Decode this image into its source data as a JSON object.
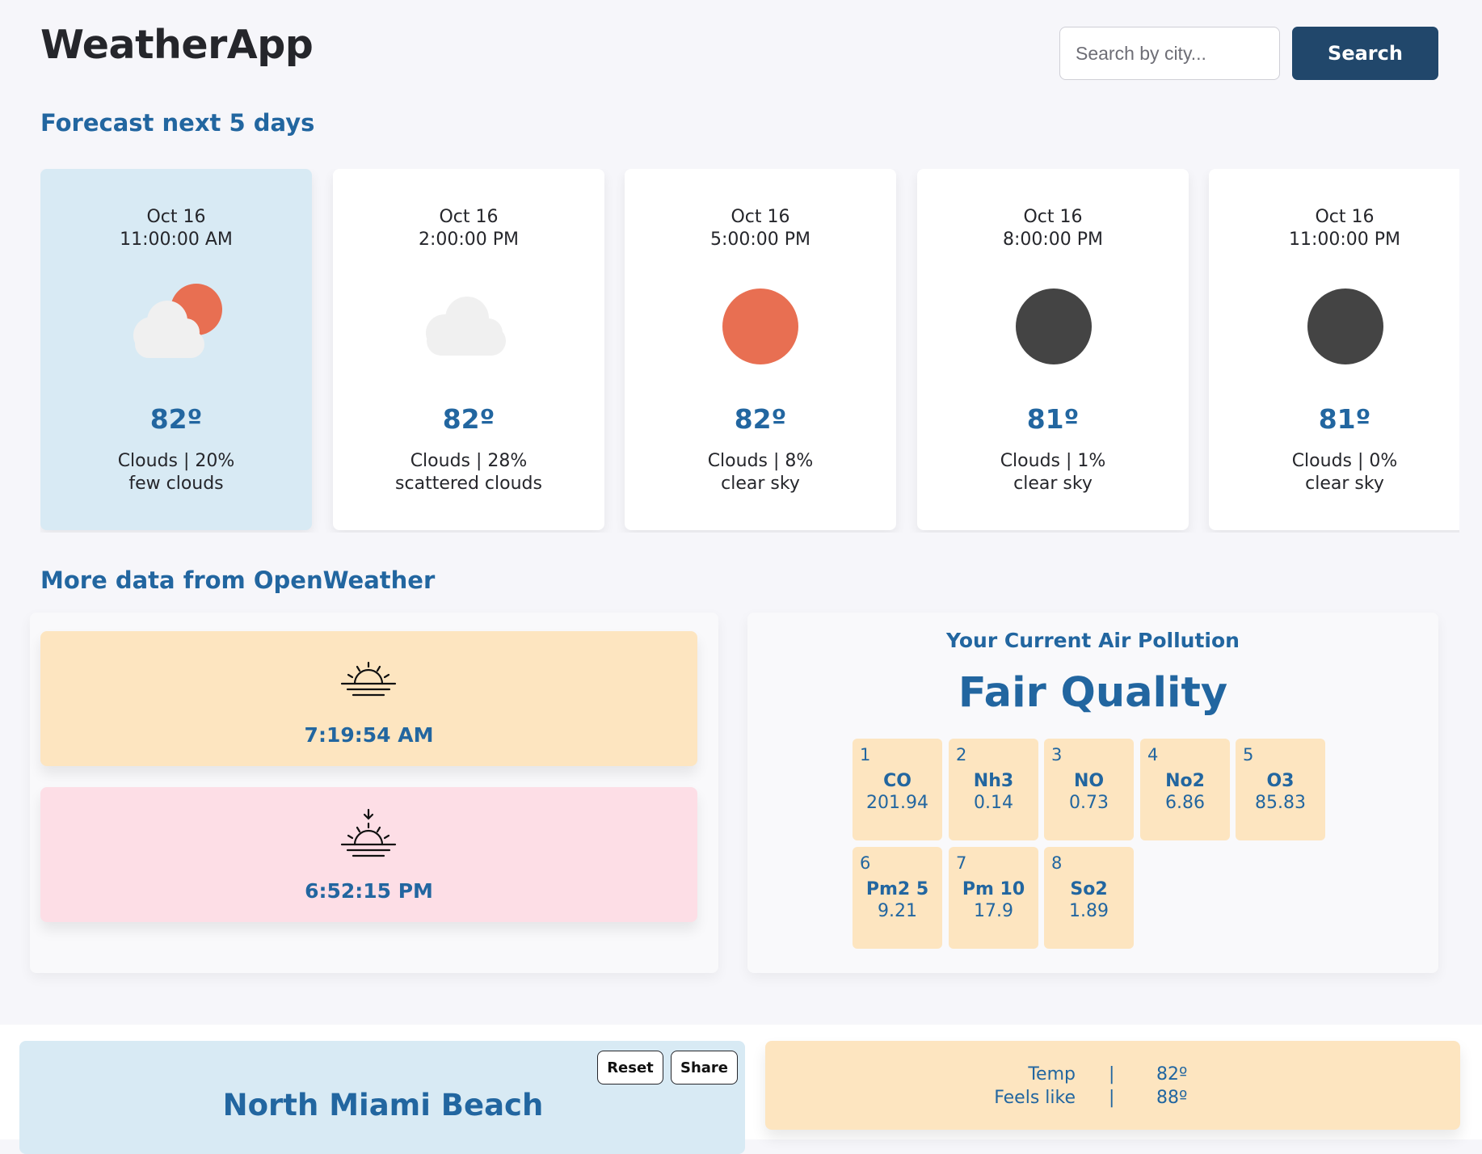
{
  "header": {
    "app_title": "WeatherApp",
    "search_placeholder": "Search by city...",
    "search_button": "Search"
  },
  "forecast": {
    "section_title": "Forecast next 5 days",
    "cards": [
      {
        "date": "Oct 16",
        "time": "11:00:00 AM",
        "icon": "partly-cloudy-icon",
        "temp": "82º",
        "summary": "Clouds | 20%",
        "description": "few clouds",
        "selected": true
      },
      {
        "date": "Oct 16",
        "time": "2:00:00 PM",
        "icon": "cloud-icon",
        "temp": "82º",
        "summary": "Clouds | 28%",
        "description": "scattered clouds",
        "selected": false
      },
      {
        "date": "Oct 16",
        "time": "5:00:00 PM",
        "icon": "sun-icon",
        "temp": "82º",
        "summary": "Clouds | 8%",
        "description": "clear sky",
        "selected": false
      },
      {
        "date": "Oct 16",
        "time": "8:00:00 PM",
        "icon": "moon-icon",
        "temp": "81º",
        "summary": "Clouds | 1%",
        "description": "clear sky",
        "selected": false
      },
      {
        "date": "Oct 16",
        "time": "11:00:00 PM",
        "icon": "moon-icon",
        "temp": "81º",
        "summary": "Clouds | 0%",
        "description": "clear sky",
        "selected": false
      }
    ]
  },
  "more_data": {
    "section_title": "More data from OpenWeather",
    "sunrise": {
      "icon": "sunrise-icon",
      "time": "7:19:54 AM"
    },
    "sunset": {
      "icon": "sunset-icon",
      "time": "6:52:15 PM"
    }
  },
  "air_pollution": {
    "title": "Your Current Air Pollution",
    "quality": "Fair Quality",
    "components": [
      {
        "index": "1",
        "name": "CO",
        "value": "201.94"
      },
      {
        "index": "2",
        "name": "Nh3",
        "value": "0.14"
      },
      {
        "index": "3",
        "name": "NO",
        "value": "0.73"
      },
      {
        "index": "4",
        "name": "No2",
        "value": "6.86"
      },
      {
        "index": "5",
        "name": "O3",
        "value": "85.83"
      },
      {
        "index": "6",
        "name": "Pm2 5",
        "value": "9.21"
      },
      {
        "index": "7",
        "name": "Pm 10",
        "value": "17.9"
      },
      {
        "index": "8",
        "name": "So2",
        "value": "1.89"
      }
    ]
  },
  "location": {
    "name": "North Miami Beach",
    "reset_button": "Reset",
    "share_button": "Share"
  },
  "current": {
    "temp_label": "Temp",
    "temp_value": "82º",
    "feels_like_label": "Feels like",
    "feels_like_value": "88º",
    "separator": "|"
  },
  "colors": {
    "accent": "#2266a0",
    "button": "#21476b",
    "selected_card": "#d8eaf4",
    "sunrise_bg": "#fde5c0",
    "sunset_bg": "#fddee6",
    "sun": "#e86f52",
    "moon": "#444444",
    "cloud": "#f0f0f0"
  }
}
